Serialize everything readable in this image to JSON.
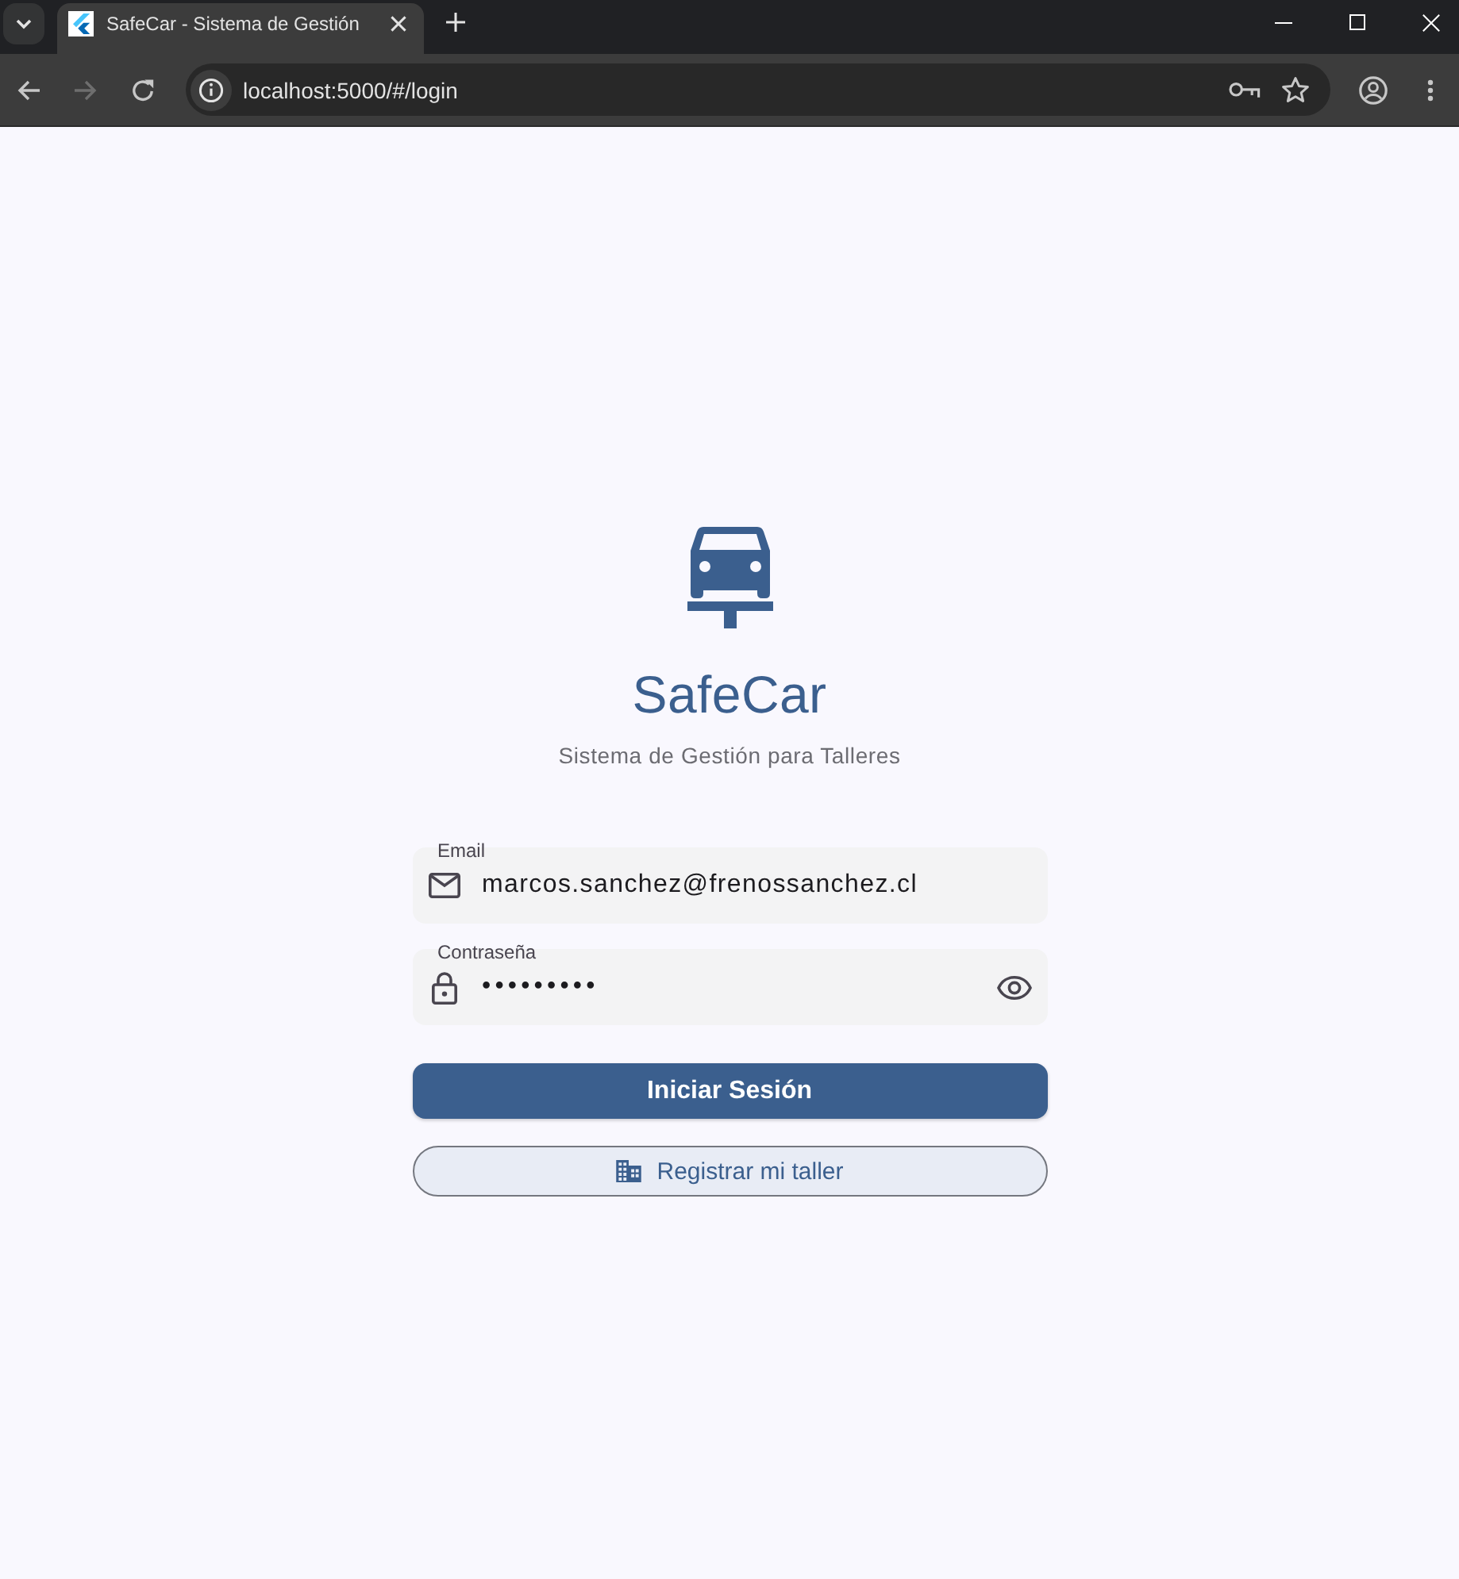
{
  "browser": {
    "tabs": [
      {
        "title": "SafeCar - Sistema de Gestión",
        "selected": true
      }
    ],
    "nav_buttons": [
      {
        "kind": "back",
        "disabled": false
      },
      {
        "kind": "forward",
        "disabled": true
      },
      {
        "kind": "reload",
        "disabled": false
      }
    ],
    "address": "localhost:5000/#/login"
  },
  "brand": {
    "name": "SafeCar",
    "tagline": "Sistema de Gestión para Talleres"
  },
  "form": {
    "fields": [
      {
        "kind": "email",
        "label": "Email",
        "value": "marcos.sanchez@frenossanchez.cl"
      },
      {
        "kind": "password",
        "label": "Contraseña",
        "value": "•••••••••"
      }
    ],
    "submit_button": "Iniciar Sesión",
    "register_button": "Registrar mi taller"
  }
}
